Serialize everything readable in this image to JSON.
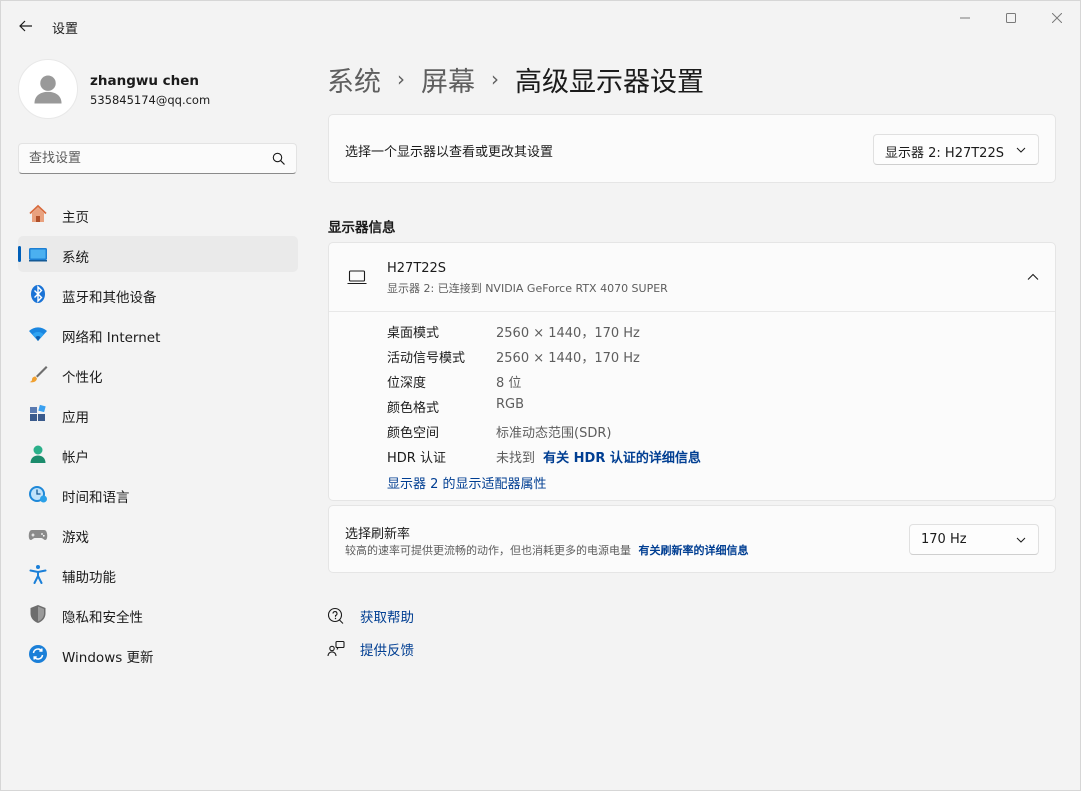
{
  "window": {
    "title": "设置",
    "back_icon": "arrow-left-icon",
    "controls": [
      "minimize-icon",
      "maximize-icon",
      "close-icon"
    ]
  },
  "profile": {
    "name": "zhangwu chen",
    "email": "535845174@qq.com"
  },
  "search": {
    "placeholder": "查找设置"
  },
  "sidebar": {
    "items": [
      {
        "label": "主页",
        "icon": "home-icon",
        "active": false
      },
      {
        "label": "系统",
        "icon": "system-display-icon",
        "active": true
      },
      {
        "label": "蓝牙和其他设备",
        "icon": "bluetooth-icon",
        "active": false
      },
      {
        "label": "网络和 Internet",
        "icon": "wifi-icon",
        "active": false
      },
      {
        "label": "个性化",
        "icon": "brush-icon",
        "active": false
      },
      {
        "label": "应用",
        "icon": "apps-icon",
        "active": false
      },
      {
        "label": "帐户",
        "icon": "account-icon",
        "active": false
      },
      {
        "label": "时间和语言",
        "icon": "time-language-icon",
        "active": false
      },
      {
        "label": "游戏",
        "icon": "gamepad-icon",
        "active": false
      },
      {
        "label": "辅助功能",
        "icon": "accessibility-icon",
        "active": false
      },
      {
        "label": "隐私和安全性",
        "icon": "shield-icon",
        "active": false
      },
      {
        "label": "Windows 更新",
        "icon": "windows-update-icon",
        "active": false
      }
    ]
  },
  "breadcrumb": {
    "items": [
      "系统",
      "屏幕"
    ],
    "current": "高级显示器设置",
    "separator": "›"
  },
  "select_display": {
    "label": "选择一个显示器以查看或更改其设置",
    "value": "显示器 2: H27T22S"
  },
  "display_info": {
    "section_title": "显示器信息",
    "monitor_name": "H27T22S",
    "monitor_sub": "显示器 2: 已连接到 NVIDIA GeForce RTX 4070 SUPER",
    "rows": [
      {
        "label": "桌面模式",
        "value": "2560 × 1440，170 Hz"
      },
      {
        "label": "活动信号模式",
        "value": "2560 × 1440，170 Hz"
      },
      {
        "label": "位深度",
        "value": "8 位"
      },
      {
        "label": "颜色格式",
        "value": "RGB"
      },
      {
        "label": "颜色空间",
        "value": "标准动态范围(SDR)"
      }
    ],
    "hdr_label": "HDR 认证",
    "hdr_value": "未找到",
    "hdr_link": "有关 HDR 认证的详细信息",
    "adapter_link": "显示器 2 的显示适配器属性"
  },
  "refresh": {
    "title": "选择刷新率",
    "description": "较高的速率可提供更流畅的动作，但也消耗更多的电源电量",
    "link": "有关刷新率的详细信息",
    "value": "170 Hz"
  },
  "help": {
    "get_help": "获取帮助",
    "feedback": "提供反馈"
  },
  "colors": {
    "accent": "#005fb8",
    "link": "#003e92",
    "background": "#f3f3f3",
    "card": "#fbfbfb"
  }
}
